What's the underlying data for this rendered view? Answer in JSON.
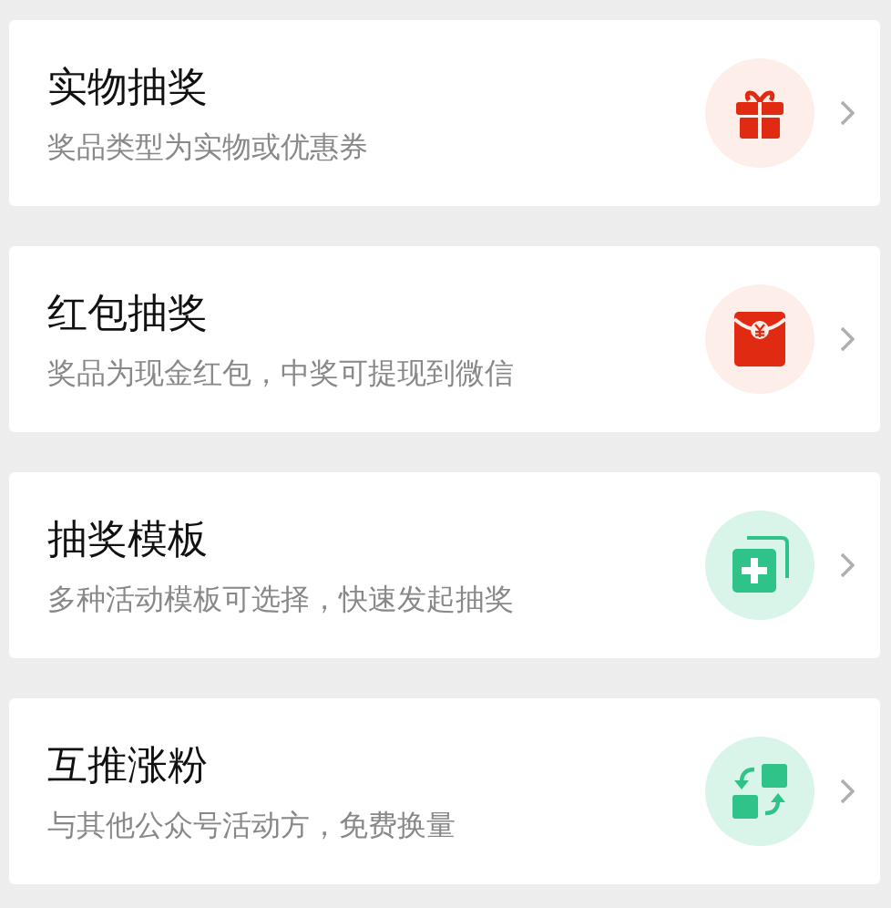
{
  "options": [
    {
      "title": "实物抽奖",
      "subtitle": "奖品类型为实物或优惠券",
      "kind": "gift"
    },
    {
      "title": "红包抽奖",
      "subtitle": "奖品为现金红包，中奖可提现到微信",
      "kind": "red-packet"
    },
    {
      "title": "抽奖模板",
      "subtitle": "多种活动模板可选择，快速发起抽奖",
      "kind": "template"
    },
    {
      "title": "互推涨粉",
      "subtitle": "与其他公众号活动方，免费换量",
      "kind": "swap"
    }
  ]
}
